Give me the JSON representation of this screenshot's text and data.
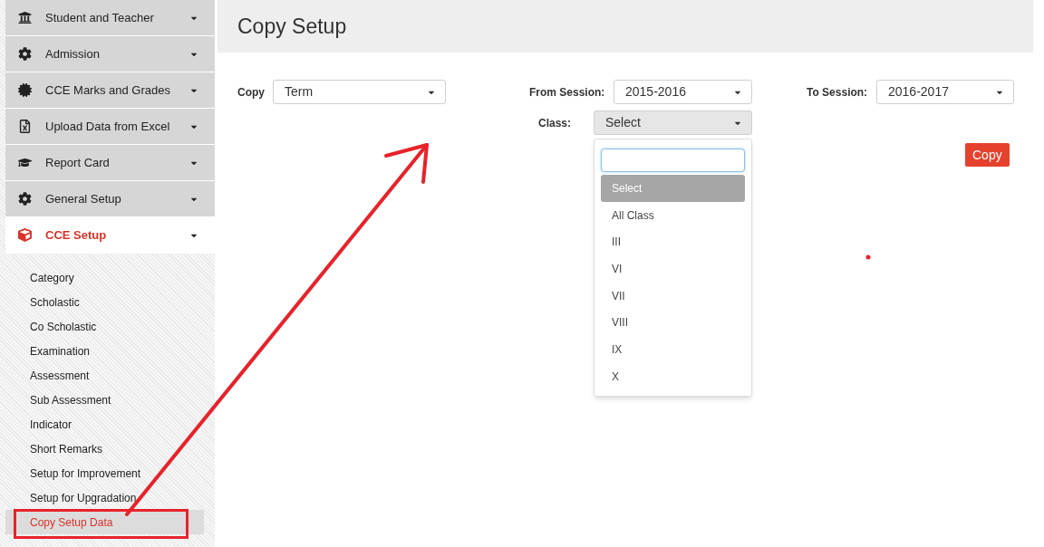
{
  "sidebar": {
    "items": [
      {
        "label": "Student and Teacher",
        "expanded": false
      },
      {
        "label": "Admission",
        "expanded": false
      },
      {
        "label": "CCE Marks and Grades",
        "expanded": false
      },
      {
        "label": "Upload Data from Excel",
        "expanded": false
      },
      {
        "label": "Report Card",
        "expanded": false
      },
      {
        "label": "General Setup",
        "expanded": false
      },
      {
        "label": "CCE Setup",
        "expanded": true,
        "children": [
          {
            "label": "Category",
            "selected": false
          },
          {
            "label": "Scholastic",
            "selected": false
          },
          {
            "label": "Co Scholastic",
            "selected": false
          },
          {
            "label": "Examination",
            "selected": false
          },
          {
            "label": "Assessment",
            "selected": false
          },
          {
            "label": "Sub Assessment",
            "selected": false
          },
          {
            "label": "Indicator",
            "selected": false
          },
          {
            "label": "Short Remarks",
            "selected": false
          },
          {
            "label": "Setup for Improvement",
            "selected": false
          },
          {
            "label": "Setup for Upgradation",
            "selected": false
          },
          {
            "label": "Copy Setup Data",
            "selected": true
          }
        ]
      }
    ]
  },
  "page": {
    "title": "Copy Setup"
  },
  "form": {
    "copy": {
      "label": "Copy",
      "value": "Term"
    },
    "from_session": {
      "label": "From Session:",
      "value": "2015-2016"
    },
    "to_session": {
      "label": "To Session:",
      "value": "2016-2017"
    },
    "class": {
      "label": "Class:",
      "value": "Select",
      "expanded": true,
      "options": [
        {
          "label": "Select",
          "selected": true
        },
        {
          "label": "All Class",
          "selected": false
        },
        {
          "label": "III",
          "selected": false
        },
        {
          "label": "VI",
          "selected": false
        },
        {
          "label": "VII",
          "selected": false
        },
        {
          "label": "VIII",
          "selected": false
        },
        {
          "label": "IX",
          "selected": false
        },
        {
          "label": "X",
          "selected": false
        }
      ]
    },
    "button": "Copy"
  }
}
